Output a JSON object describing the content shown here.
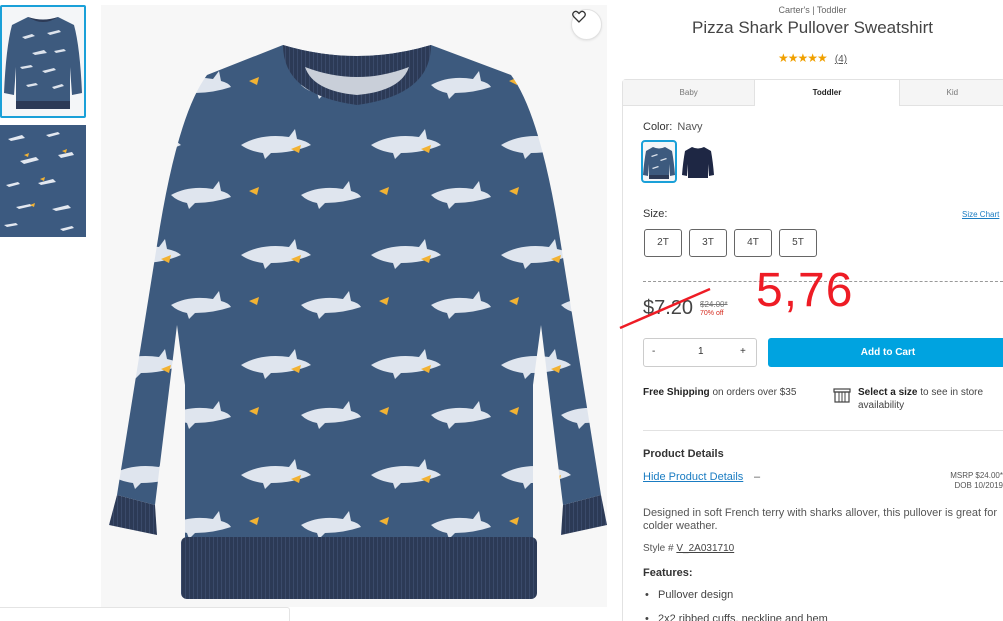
{
  "product": {
    "brand_line": "Carter's | Toddler",
    "title": "Pizza Shark Pullover Sweatshirt",
    "stars": "★★★★★",
    "review_count": "(4)"
  },
  "tabs": [
    {
      "label": "Baby"
    },
    {
      "label": "Toddler",
      "active": true
    },
    {
      "label": "Kid"
    }
  ],
  "color": {
    "label": "Color:",
    "value": "Navy",
    "swatches": [
      "shark-print",
      "solid-navy"
    ]
  },
  "size": {
    "label": "Size:",
    "chart_link": "Size Chart",
    "options": [
      "2T",
      "3T",
      "4T",
      "5T"
    ]
  },
  "price": {
    "current": "$7.20",
    "original": "$24.00*",
    "percent_off": "70% off",
    "annotation": "5,76"
  },
  "quantity": {
    "minus": "-",
    "value": "1",
    "plus": "+"
  },
  "add_to_cart": "Add to Cart",
  "shipping": {
    "bold": "Free Shipping",
    "rest": " on orders over $35"
  },
  "store": {
    "bold": "Select a size",
    "rest": " to see in store availability"
  },
  "details": {
    "title": "Product Details",
    "hide_link": "Hide Product Details",
    "dash": "–",
    "msrp": "MSRP $24.00*",
    "dob": "DOB 10/2019",
    "description": "Designed in soft French terry with sharks allover, this pullover is great for colder weather.",
    "style_label": "Style #",
    "style_id": "V_2A031710",
    "features_title": "Features:",
    "features": [
      "Pullover design",
      "2x2 ribbed cuffs, neckline and hem"
    ]
  },
  "colors": {
    "accent": "#00a3e0",
    "selected_border": "#1aa0d8",
    "star": "#f0a000",
    "sale_red": "#d52b1e",
    "annotation_red": "#ee1c25",
    "sweatshirt": "#3d5a7e",
    "rib": "#2c3a56"
  },
  "icons": {
    "wishlist": "heart-icon",
    "store": "store-icon"
  }
}
